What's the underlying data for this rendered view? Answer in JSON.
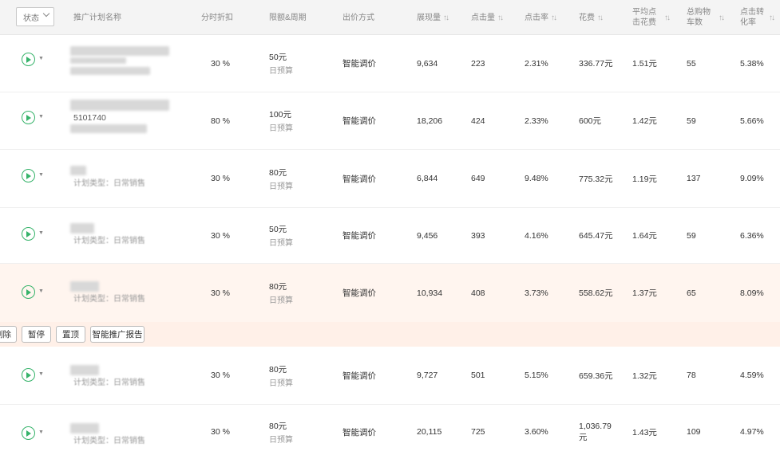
{
  "header": {
    "status_filter": "状态",
    "columns": {
      "name": "推广计划名称",
      "discount": "分时折扣",
      "budget": "限额&周期",
      "bid": "出价方式",
      "impressions": "展现量",
      "clicks": "点击量",
      "ctr": "点击率",
      "cost": "花费",
      "cpc_line1": "平均点",
      "cpc_line2": "击花费",
      "cart_line1": "总购物",
      "cart_line2": "车数",
      "cvr_line1": "点击转",
      "cvr_line2": "化率"
    }
  },
  "rows": [
    {
      "id_text": "",
      "type_text": "",
      "discount": "30 %",
      "budget": "50元",
      "budget_period": "日预算",
      "bid": "智能调价",
      "impressions": "9,634",
      "clicks": "223",
      "ctr": "2.31%",
      "cost": "336.77元",
      "cost2": "",
      "cpc": "1.51元",
      "carts": "55",
      "cvr": "5.38%"
    },
    {
      "id_text": "5101740",
      "type_text": "",
      "discount": "80 %",
      "budget": "100元",
      "budget_period": "日预算",
      "bid": "智能调价",
      "impressions": "18,206",
      "clicks": "424",
      "ctr": "2.33%",
      "cost": "600元",
      "cost2": "",
      "cpc": "1.42元",
      "carts": "59",
      "cvr": "5.66%"
    },
    {
      "id_text": "",
      "type_text": "计划类型：日常销售",
      "discount": "30 %",
      "budget": "80元",
      "budget_period": "日预算",
      "bid": "智能调价",
      "impressions": "6,844",
      "clicks": "649",
      "ctr": "9.48%",
      "cost": "775.32元",
      "cost2": "",
      "cpc": "1.19元",
      "carts": "137",
      "cvr": "9.09%"
    },
    {
      "id_text": "",
      "type_text": "计划类型：日常销售",
      "discount": "30 %",
      "budget": "50元",
      "budget_period": "日预算",
      "bid": "智能调价",
      "impressions": "9,456",
      "clicks": "393",
      "ctr": "4.16%",
      "cost": "645.47元",
      "cost2": "",
      "cpc": "1.64元",
      "carts": "59",
      "cvr": "6.36%"
    },
    {
      "id_text": "",
      "type_text": "计划类型：日常销售",
      "discount": "30 %",
      "budget": "80元",
      "budget_period": "日预算",
      "bid": "智能调价",
      "impressions": "10,934",
      "clicks": "408",
      "ctr": "3.73%",
      "cost": "558.62元",
      "cost2": "",
      "cpc": "1.37元",
      "carts": "65",
      "cvr": "8.09%"
    },
    {
      "id_text": "",
      "type_text": "计划类型：日常销售",
      "discount": "30 %",
      "budget": "80元",
      "budget_period": "日预算",
      "bid": "智能调价",
      "impressions": "9,727",
      "clicks": "501",
      "ctr": "5.15%",
      "cost": "659.36元",
      "cost2": "",
      "cpc": "1.32元",
      "carts": "78",
      "cvr": "4.59%"
    },
    {
      "id_text": "",
      "type_text": "计划类型：日常销售",
      "discount": "30 %",
      "budget": "80元",
      "budget_period": "日预算",
      "bid": "智能调价",
      "impressions": "20,115",
      "clicks": "725",
      "ctr": "3.60%",
      "cost": "1,036.79",
      "cost2": "元",
      "cpc": "1.43元",
      "carts": "109",
      "cvr": "4.97%"
    }
  ],
  "actions": {
    "delete": "删除",
    "pause": "暂停",
    "pin": "置顶",
    "report": "智能推广报告"
  },
  "icons": {
    "play": "play-circle-icon",
    "caret": "caret-down-icon",
    "sort": "sort-icon"
  },
  "colors": {
    "accent_green": "#36b36a",
    "highlight_row": "#fff5ef",
    "action_bar": "#fff0e8"
  }
}
